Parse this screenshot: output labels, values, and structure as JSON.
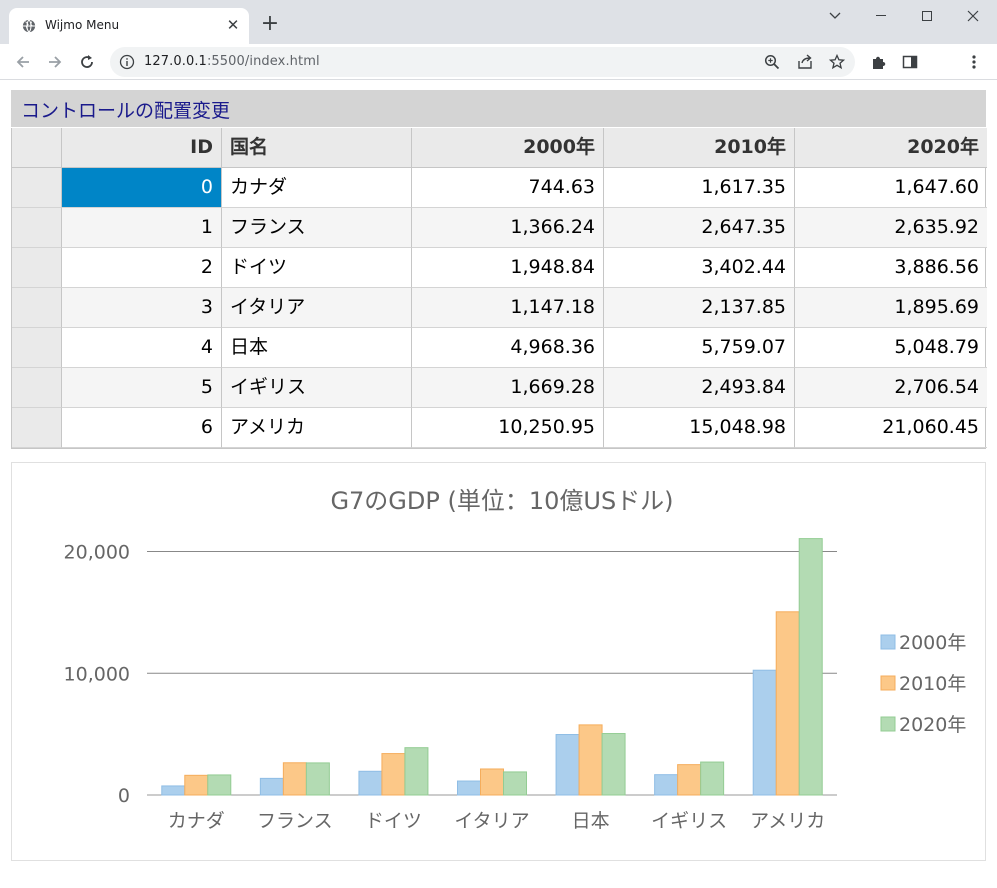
{
  "browser": {
    "tab_title": "Wijmo Menu",
    "url_host": "127.0.0.1",
    "url_rest": ":5500/index.html"
  },
  "page": {
    "header_title": "コントロールの配置変更"
  },
  "grid": {
    "columns": [
      "ID",
      "国名",
      "2000年",
      "2010年",
      "2020年"
    ],
    "rows": [
      {
        "id": "0",
        "country": "カナダ",
        "y2000": "744.63",
        "y2010": "1,617.35",
        "y2020": "1,647.60"
      },
      {
        "id": "1",
        "country": "フランス",
        "y2000": "1,366.24",
        "y2010": "2,647.35",
        "y2020": "2,635.92"
      },
      {
        "id": "2",
        "country": "ドイツ",
        "y2000": "1,948.84",
        "y2010": "3,402.44",
        "y2020": "3,886.56"
      },
      {
        "id": "3",
        "country": "イタリア",
        "y2000": "1,147.18",
        "y2010": "2,137.85",
        "y2020": "1,895.69"
      },
      {
        "id": "4",
        "country": "日本",
        "y2000": "4,968.36",
        "y2010": "5,759.07",
        "y2020": "5,048.79"
      },
      {
        "id": "5",
        "country": "イギリス",
        "y2000": "1,669.28",
        "y2010": "2,493.84",
        "y2020": "2,706.54"
      },
      {
        "id": "6",
        "country": "アメリカ",
        "y2000": "10,250.95",
        "y2010": "15,048.98",
        "y2020": "21,060.45"
      }
    ],
    "selected_row": 0
  },
  "colors": {
    "series_fill": [
      "#abcfed",
      "#fcc888",
      "#b3dbb3"
    ],
    "series_stroke": [
      "#8fbde5",
      "#f5ad5c",
      "#93cc93"
    ],
    "selection": "#0085c7"
  },
  "chart_data": {
    "type": "bar",
    "title": "G7のGDP (単位：10億USドル)",
    "categories": [
      "カナダ",
      "フランス",
      "ドイツ",
      "イタリア",
      "日本",
      "イギリス",
      "アメリカ"
    ],
    "series": [
      {
        "name": "2000年",
        "values": [
          744.63,
          1366.24,
          1948.84,
          1147.18,
          4968.36,
          1669.28,
          10250.95
        ]
      },
      {
        "name": "2010年",
        "values": [
          1617.35,
          2647.35,
          3402.44,
          2137.85,
          5759.07,
          2493.84,
          15048.98
        ]
      },
      {
        "name": "2020年",
        "values": [
          1647.6,
          2635.92,
          3886.56,
          1895.69,
          5048.79,
          2706.54,
          21060.45
        ]
      }
    ],
    "ylim": [
      0,
      23000
    ],
    "yticks": [
      0,
      10000,
      20000
    ],
    "ytick_labels": [
      "0",
      "10,000",
      "20,000"
    ],
    "grid": "horizontal",
    "legend": "right"
  }
}
